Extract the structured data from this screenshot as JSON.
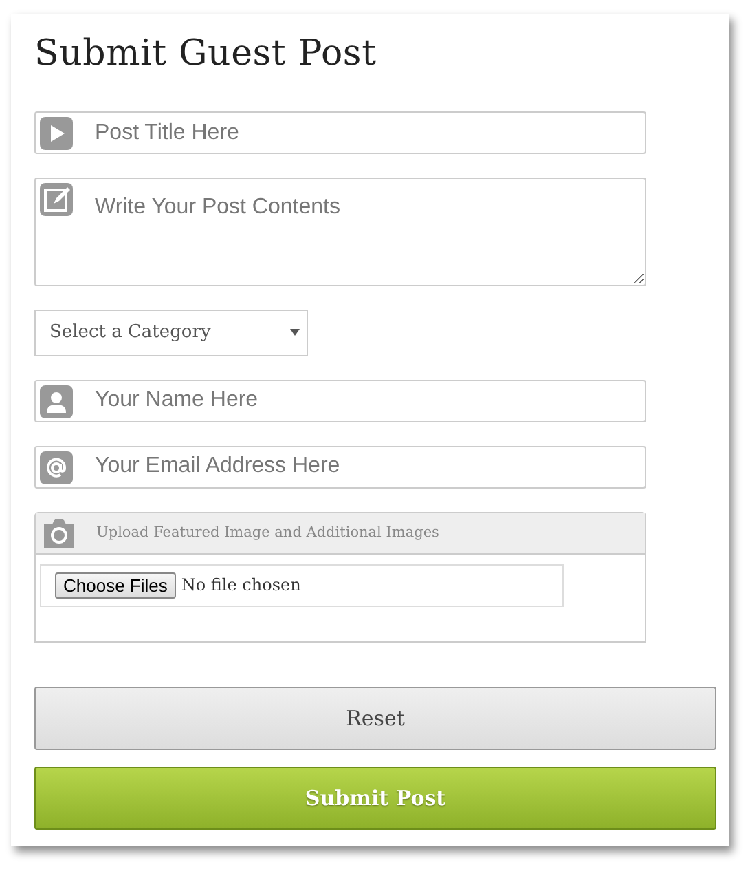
{
  "title": "Submit Guest Post",
  "fields": [
    {
      "kind": "title",
      "placeholder": "Post Title Here"
    },
    {
      "kind": "content",
      "placeholder": "Write Your Post Contents"
    },
    {
      "kind": "category",
      "value": "Select a Category"
    },
    {
      "kind": "name",
      "placeholder": "Your Name Here"
    },
    {
      "kind": "email",
      "placeholder": "Your Email Address Here"
    },
    {
      "kind": "upload",
      "label": "Upload Featured Image and Additional Images",
      "button": "Choose Files",
      "status": "No file chosen"
    }
  ],
  "buttons": [
    {
      "kind": "reset",
      "label": "Reset"
    },
    {
      "kind": "submit",
      "label": "Submit Post"
    }
  ]
}
